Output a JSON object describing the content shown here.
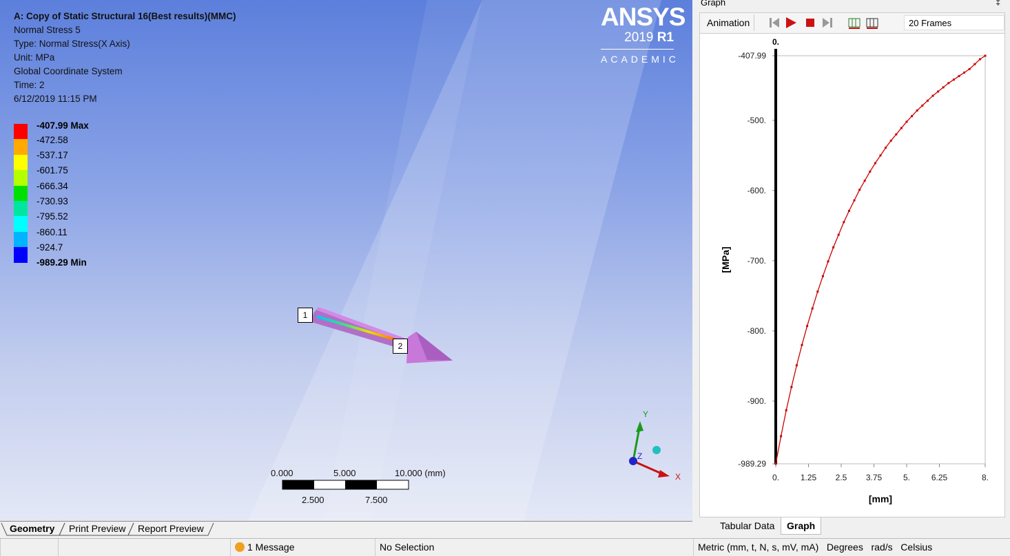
{
  "info": {
    "title": "A: Copy of Static Structural 16(Best results)(MMC)",
    "lines": [
      "Normal Stress 5",
      "Type: Normal Stress(X Axis)",
      "Unit: MPa",
      "Global Coordinate System",
      "Time: 2",
      "6/12/2019 11:15 PM"
    ]
  },
  "legend": {
    "labels": [
      "-407.99 Max",
      "-472.58",
      "-537.17",
      "-601.75",
      "-666.34",
      "-730.93",
      "-795.52",
      "-860.11",
      "-924.7",
      "-989.29 Min"
    ],
    "colors": [
      "#ff0000",
      "#ffaa00",
      "#ffff00",
      "#b4ff00",
      "#00e000",
      "#00e6a0",
      "#00ffff",
      "#00b4ff",
      "#0000ff"
    ]
  },
  "logo": {
    "brand": "ANSYS",
    "version": "2019",
    "release": "R1",
    "edition": "ACADEMIC"
  },
  "probes": [
    "1",
    "2"
  ],
  "scale": {
    "top": [
      "0.000",
      "5.000",
      "10.000 (mm)"
    ],
    "bottom": [
      "2.500",
      "7.500"
    ]
  },
  "triad": {
    "x": "X",
    "y": "Y",
    "z": "Z"
  },
  "view_tabs": [
    "Geometry",
    "Print Preview",
    "Report Preview"
  ],
  "graph_panel": {
    "title": "Graph",
    "pin": "‡",
    "animation_label": "Animation",
    "frames": "20 Frames",
    "cursor_label": "0.",
    "ylabel": "[MPa]",
    "xlabel": "[mm]",
    "tabs": [
      "Tabular Data",
      "Graph"
    ]
  },
  "chart_data": {
    "type": "line",
    "xlabel": "[mm]",
    "ylabel": "[MPa]",
    "xlim": [
      0,
      8
    ],
    "ylim": [
      -989.29,
      -407.99
    ],
    "xticks": [
      "0.",
      "1.25",
      "2.5",
      "3.75",
      "5.",
      "6.25",
      "8."
    ],
    "yticks": [
      "-407.99",
      "-500.",
      "-600.",
      "-700.",
      "-800.",
      "-900.",
      "-989.29"
    ],
    "ytick_values": [
      -407.99,
      -500,
      -600,
      -700,
      -800,
      -900,
      -989.29
    ],
    "xtick_values": [
      0,
      1.25,
      2.5,
      3.75,
      5,
      6.25,
      8
    ],
    "line_color": "#cc0000",
    "series": [
      {
        "x": [
          0,
          0.2,
          0.4,
          0.6,
          0.8,
          1.0,
          1.2,
          1.4,
          1.6,
          1.8,
          2.0,
          2.2,
          2.4,
          2.6,
          2.8,
          3.0,
          3.2,
          3.4,
          3.6,
          3.8,
          4.0,
          4.2,
          4.4,
          4.6,
          4.8,
          5.0,
          5.2,
          5.4,
          5.6,
          5.8,
          6.0,
          6.2,
          6.4,
          6.6,
          6.8,
          7.0,
          7.2,
          7.4,
          7.6,
          7.8,
          8.0
        ],
        "y": [
          -989.29,
          -950,
          -913,
          -880,
          -849,
          -820,
          -793,
          -768,
          -744,
          -722,
          -701,
          -681,
          -663,
          -645,
          -629,
          -614,
          -599,
          -586,
          -573,
          -561,
          -550,
          -539,
          -529,
          -520,
          -511,
          -502,
          -494,
          -486,
          -479,
          -472,
          -465,
          -459,
          -453,
          -447,
          -442,
          -437,
          -432,
          -427,
          -420,
          -413,
          -407.99
        ]
      }
    ]
  },
  "status": {
    "message": "1 Message",
    "selection": "No Selection",
    "units": "Metric (mm, t, N, s, mV, mA)   Degrees   rad/s   Celsius"
  }
}
